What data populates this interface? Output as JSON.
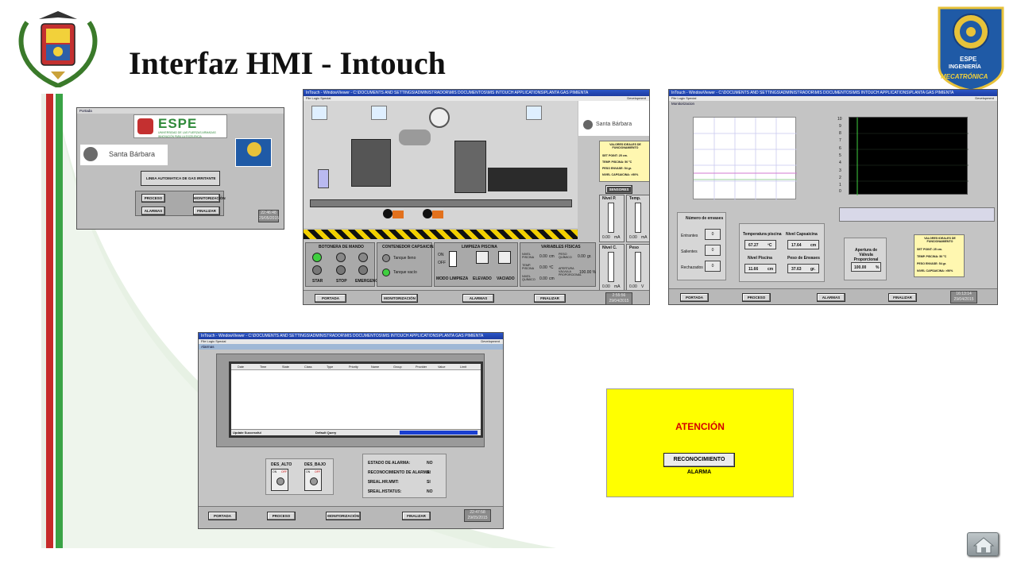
{
  "slide": {
    "title": "Interfaz HMI - Intouch"
  },
  "logos": {
    "right_line1": "ESPE",
    "right_line2": "INGENIERÍA",
    "right_line3": "MECATRÓNICA"
  },
  "portada": {
    "window_title": "Portada",
    "espe_text": "ESPE",
    "espe_subtitle": "UNIVERSIDAD DE LAS FUERZAS ARMADAS",
    "espe_motto": "INNOVACIÓN PARA LA EXCELENCIA",
    "company": "Santa Bárbara",
    "line_title": "LINEA AUTOMATICA DE GAS IRRITANTE",
    "buttons": [
      "PROCESO",
      "MONITORIZACIÓN",
      "ALARMAS",
      "FINALIZAR"
    ],
    "clock_time": "22:46:48",
    "clock_date": "29/05/2015"
  },
  "proceso": {
    "window_title": "InTouch - WindowViewer - C:\\DOCUMENTS AND SETTINGS\\ADMINISTRADOR\\MIS DOCUMENTOS\\MIS INTOUCH APPLICATIONS\\PLANTA GAS PIMIENTA",
    "menu": "File  Logic  Special",
    "mode": "Development",
    "company": "Santa Bárbara",
    "ideal_title": "VALORES IDEALES DE FUNCIONAMIENTO",
    "ideal_lines": [
      "SET POINT: 25 cm.",
      "TEMP. PISCINA: 50 ºC",
      "PESO ENVASE: 54 gr.",
      "NIVEL CAPSAICINA: >50%"
    ],
    "sensores": "SENSORES",
    "gauges": [
      {
        "label": "Nivel P.",
        "value": "0.00",
        "unit": "mA",
        "tag": "ULTRASONI"
      },
      {
        "label": "Temp.",
        "value": "0.00",
        "unit": "mA",
        "tag": "PT 100"
      },
      {
        "label": "Nivel C.",
        "value": "0.00",
        "unit": "mA",
        "tag": "ULTRASONI"
      },
      {
        "label": "Peso",
        "value": "0.00",
        "unit": "V",
        "tag": "CELDA"
      }
    ],
    "sections": [
      "BOTONERA DE MANDO",
      "CONTENEDOR CAPSAICINA",
      "LIMPIEZA PISCINA",
      "VARIABLES FÍSICAS"
    ],
    "push_labels": [
      "STAR",
      "STOP",
      "EMERGENCY"
    ],
    "tank_full": "Tanque lleno",
    "tank_empty": "Tanque vacío",
    "switch_on": "ON",
    "switch_off": "OFF",
    "cleaning_labels": [
      "MODO LIMPIEZA",
      "ELEVADO",
      "VACIADO"
    ],
    "vars": [
      {
        "label": "NIVEL PISCINA",
        "value": "0.00",
        "unit": "cm"
      },
      {
        "label": "TEMP. PISCINA",
        "value": "0.00",
        "unit": "ºC"
      },
      {
        "label": "NIVEL QUÍMICO",
        "value": "0.00",
        "unit": "cm"
      }
    ],
    "peso_label": "PESO QUÍMICO",
    "peso_value": "0.00",
    "peso_unit": "gr.",
    "valve_label": "APERTURA VÁLVULA PROPORCIONAL",
    "valve_value": "100.00 %",
    "nav_buttons": [
      "PORTADA",
      "MONITORIZACIÓN",
      "ALARMAS",
      "FINALIZAR"
    ],
    "clock_time": "2:55:56",
    "clock_date": "29/04/2015"
  },
  "monitorizacion": {
    "window_title": "InTouch - WindowViewer - C:\\DOCUMENTS AND SETTINGS\\ADMINISTRADOR\\MIS DOCUMENTOS\\MIS INTOUCH APPLICATIONS\\PLANTA GAS PIMIENTA",
    "menu": "File  Logic  Special",
    "mode": "Development",
    "sub_title": "Monitorizacion",
    "y_ticks": [
      "10",
      "9",
      "8",
      "7",
      "6",
      "5",
      "4",
      "3",
      "2",
      "1",
      "0"
    ],
    "envases_title": "Número de envases",
    "envases_rows": [
      {
        "label": "Entrantes",
        "value": "0"
      },
      {
        "label": "Salientes",
        "value": "0"
      },
      {
        "label": "Rechazados",
        "value": "0"
      }
    ],
    "temp_label": "Temperatura piscina",
    "temp_value": "67.27",
    "temp_unit": "ºC",
    "nivelcap_label": "Nivel Capsaicina",
    "nivelcap_value": "17.64",
    "nivelcap_unit": "cm",
    "nivelpis_label": "Nivel Piscina",
    "nivelpis_value": "11.66",
    "nivelpis_unit": "cm",
    "peso_label": "Peso de Envases",
    "peso_value": "37.63",
    "peso_unit": "gr.",
    "valve_label": "Apertura de Válvula Proporcional",
    "valve_value": "100.00",
    "valve_unit": "%",
    "ideal_title": "VALORES IDEALES DE FUNCIONAMIENTO",
    "ideal_lines": [
      "SET POINT: 25 cm.",
      "TEMP. PISCINA: 50 ºC",
      "PESO ENVASE: 54 gr.",
      "NIVEL CAPSAICINA: >50%"
    ],
    "nav_buttons": [
      "PORTADA",
      "PROCESO",
      "ALARMAS",
      "FINALIZAR"
    ],
    "clock_time": "16:13:14",
    "clock_date": "29/04/2015"
  },
  "alarmas": {
    "window_title": "InTouch - WindowViewer - C:\\DOCUMENTS AND SETTINGS\\ADMINISTRADOR\\MIS DOCUMENTOS\\MIS INTOUCH APPLICATIONS\\PLANTA GAS PIMIENTA",
    "menu": "File  Logic  Special",
    "mode": "Development",
    "sub_title": "Alarmas",
    "columns": [
      "Date",
      "Time",
      "State",
      "Class",
      "Type",
      "Priority",
      "Name",
      "Group",
      "Provider",
      "Value",
      "Limit"
    ],
    "status_left": "Update Successful",
    "status_mid": "Default Query",
    "switch1": "DES_ALTO",
    "switch2": "DES_BAJO",
    "sw_on": "ON",
    "sw_off": "OFF",
    "status_rows": [
      {
        "label": "ESTADO DE ALARMA:",
        "value": "NO"
      },
      {
        "label": "RECONOCIMIENTO DE ALARMA:",
        "value": "SI"
      },
      {
        "label": "$REAL.HR.MMT:",
        "value": "SI"
      },
      {
        "label": "$REAL.HSTATUS:",
        "value": "NO"
      }
    ],
    "nav_buttons": [
      "PORTADA",
      "PROCESO",
      "MONITORIZACIÓN",
      "FINALIZAR"
    ],
    "clock_time": "22:47:58",
    "clock_date": "29/05/2015"
  },
  "attention": {
    "title": "ATENCIÓN",
    "button": "RECONOCIMIENTO ALARMA"
  }
}
